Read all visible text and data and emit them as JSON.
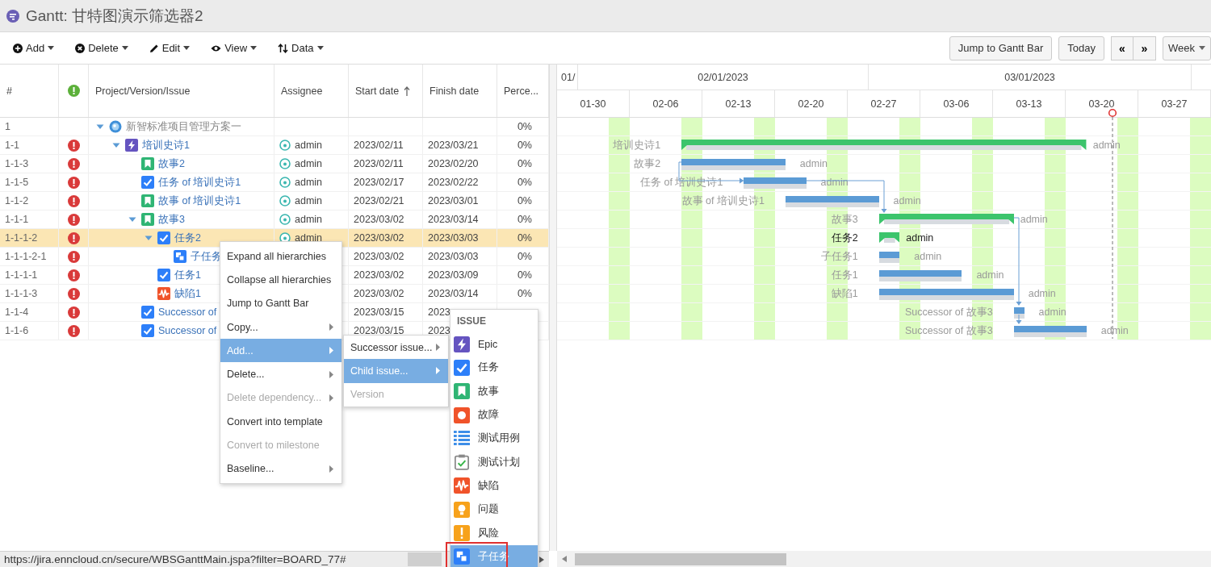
{
  "title": "Gantt: 甘特图演示筛选器2",
  "toolbar": [
    {
      "label": "Add"
    },
    {
      "label": "Delete"
    },
    {
      "label": "Edit"
    },
    {
      "label": "View"
    },
    {
      "label": "Data"
    }
  ],
  "view_controls": {
    "jump": "Jump to Gantt Bar",
    "today": "Today",
    "prev": "«",
    "next": "»",
    "scale": "Week"
  },
  "columns": [
    {
      "kind": "text",
      "label": "#",
      "sorted": false
    },
    {
      "kind": "status_icon"
    },
    {
      "kind": "text",
      "label": "Project/Version/Issue",
      "sorted": false
    },
    {
      "kind": "text",
      "label": "Assignee",
      "sorted": false
    },
    {
      "kind": "text",
      "label": "Start date",
      "sorted": true
    },
    {
      "kind": "text",
      "label": "Finish date",
      "sorted": false
    },
    {
      "kind": "text",
      "label": "Perce...",
      "sorted": false
    }
  ],
  "rows": [
    {
      "id": "1",
      "kind": "project",
      "name": "新智标准项目管理方案一",
      "percent": "0%",
      "high_priority": false,
      "selected": false,
      "expanded": true,
      "children": [
        {
          "id": "1-1",
          "kind": "epic",
          "name": "培训史诗1",
          "assignee": "admin",
          "start": "2023/02/11",
          "finish": "2023/03/21",
          "percent": "0%",
          "high_priority": true,
          "selected": false,
          "expanded": true,
          "children": [
            {
              "id": "1-1-3",
              "kind": "story",
              "name": "故事2",
              "assignee": "admin",
              "start": "2023/02/11",
              "finish": "2023/02/20",
              "percent": "0%",
              "high_priority": true,
              "selected": false
            },
            {
              "id": "1-1-5",
              "kind": "task",
              "name": "任务 of 培训史诗1",
              "assignee": "admin",
              "start": "2023/02/17",
              "finish": "2023/02/22",
              "percent": "0%",
              "high_priority": true,
              "selected": false
            },
            {
              "id": "1-1-2",
              "kind": "story",
              "name": "故事 of 培训史诗1",
              "assignee": "admin",
              "start": "2023/02/21",
              "finish": "2023/03/01",
              "percent": "0%",
              "high_priority": true,
              "selected": false
            },
            {
              "id": "1-1-1",
              "kind": "story",
              "name": "故事3",
              "assignee": "admin",
              "start": "2023/03/02",
              "finish": "2023/03/14",
              "percent": "0%",
              "high_priority": true,
              "selected": false,
              "expanded": true,
              "children": [
                {
                  "id": "1-1-1-2",
                  "kind": "task",
                  "name": "任务2",
                  "assignee": "admin",
                  "start": "2023/03/02",
                  "finish": "2023/03/03",
                  "percent": "0%",
                  "high_priority": true,
                  "selected": true,
                  "expanded": true,
                  "children": [
                    {
                      "id": "1-1-1-2-1",
                      "kind": "subtask",
                      "name": "子任务",
                      "start": "2023/03/02",
                      "finish": "2023/03/03",
                      "percent": "0%",
                      "high_priority": true,
                      "selected": false
                    }
                  ]
                },
                {
                  "id": "1-1-1-1",
                  "kind": "task",
                  "name": "任务1",
                  "start": "2023/03/02",
                  "finish": "2023/03/09",
                  "percent": "0%",
                  "high_priority": true,
                  "selected": false
                },
                {
                  "id": "1-1-1-3",
                  "kind": "defect",
                  "name": "缺陷1",
                  "start": "2023/03/02",
                  "finish": "2023/03/14",
                  "percent": "0%",
                  "high_priority": true,
                  "selected": false
                }
              ]
            },
            {
              "id": "1-1-4",
              "kind": "task",
              "name": "Successor of",
              "start": "2023/03/15",
              "finish": "2023",
              "high_priority": true,
              "selected": false
            },
            {
              "id": "1-1-6",
              "kind": "task",
              "name": "Successor of",
              "start": "2023/03/15",
              "finish": "2023",
              "high_priority": true,
              "selected": false
            }
          ]
        }
      ]
    }
  ],
  "timeline": {
    "months": [
      "01/",
      "02/01/2023",
      "03/01/2023"
    ],
    "weeks": [
      "01-30",
      "02-06",
      "02-13",
      "02-20",
      "02-27",
      "03-06",
      "03-13",
      "03-20",
      "03-27"
    ]
  },
  "bars": [
    {
      "label": "培训史诗1",
      "assignee": "admin",
      "kind": "summary",
      "selected": false
    },
    {
      "label": "故事2",
      "assignee": "admin",
      "kind": "task",
      "selected": false
    },
    {
      "label": "任务 of 培训史诗1",
      "assignee": "admin",
      "kind": "task",
      "selected": false
    },
    {
      "label": "故事 of 培训史诗1",
      "assignee": "admin",
      "kind": "task",
      "selected": false
    },
    {
      "label": "故事3",
      "assignee": "admin",
      "kind": "summary",
      "selected": false
    },
    {
      "label": "任务2",
      "assignee": "admin",
      "kind": "summary",
      "selected": true
    },
    {
      "label": "子任务1",
      "assignee": "admin",
      "kind": "task",
      "selected": false
    },
    {
      "label": "任务1",
      "assignee": "admin",
      "kind": "task",
      "selected": false
    },
    {
      "label": "缺陷1",
      "assignee": "admin",
      "kind": "task",
      "selected": false
    },
    {
      "label": "Successor of 故事3",
      "assignee": "admin",
      "kind": "task",
      "selected": false
    },
    {
      "label": "Successor of 故事3",
      "assignee": "admin",
      "kind": "task",
      "selected": false
    }
  ],
  "context_menu": {
    "items": [
      {
        "label": "Expand all hierarchies",
        "submenu": false,
        "disabled": false,
        "selected": false
      },
      {
        "label": "Collapse all hierarchies",
        "submenu": false,
        "disabled": false,
        "selected": false
      },
      {
        "label": "Jump to Gantt Bar",
        "submenu": false,
        "disabled": false,
        "selected": false
      },
      {
        "label": "Copy...",
        "submenu": true,
        "disabled": false,
        "selected": false
      },
      {
        "label": "Add...",
        "submenu": true,
        "disabled": false,
        "selected": true
      },
      {
        "label": "Delete...",
        "submenu": true,
        "disabled": false,
        "selected": false
      },
      {
        "label": "Delete dependency...",
        "submenu": true,
        "disabled": true,
        "selected": false
      },
      {
        "label": "Convert into template",
        "submenu": false,
        "disabled": false,
        "selected": false
      },
      {
        "label": "Convert to milestone",
        "submenu": false,
        "disabled": true,
        "selected": false
      },
      {
        "label": "Baseline...",
        "submenu": true,
        "disabled": false,
        "selected": false
      }
    ]
  },
  "add_menu": {
    "items": [
      {
        "label": "Successor issue...",
        "submenu": true,
        "disabled": false,
        "selected": false
      },
      {
        "label": "Child issue...",
        "submenu": true,
        "disabled": false,
        "selected": true
      },
      {
        "label": "Version",
        "submenu": false,
        "disabled": true,
        "selected": false
      }
    ]
  },
  "type_menu": {
    "heading": "ISSUE",
    "items": [
      {
        "kind": "epic",
        "label": "Epic",
        "selected": false,
        "outlined": false
      },
      {
        "kind": "task",
        "label": "任务",
        "selected": false,
        "outlined": false
      },
      {
        "kind": "story",
        "label": "故事",
        "selected": false,
        "outlined": false
      },
      {
        "kind": "fault",
        "label": "故障",
        "selected": false,
        "outlined": false
      },
      {
        "kind": "testcase",
        "label": "测试用例",
        "selected": false,
        "outlined": false
      },
      {
        "kind": "testplan",
        "label": "测试计划",
        "selected": false,
        "outlined": false
      },
      {
        "kind": "defect",
        "label": "缺陷",
        "selected": false,
        "outlined": false
      },
      {
        "kind": "question",
        "label": "问题",
        "selected": false,
        "outlined": false
      },
      {
        "kind": "risk",
        "label": "风险",
        "selected": false,
        "outlined": false
      },
      {
        "kind": "subtask",
        "label": "子任务",
        "selected": true,
        "outlined": true
      }
    ]
  },
  "status_url": "https://jira.enncloud.cn/secure/WBSGanttMain.jspa?filter=BOARD_77#"
}
